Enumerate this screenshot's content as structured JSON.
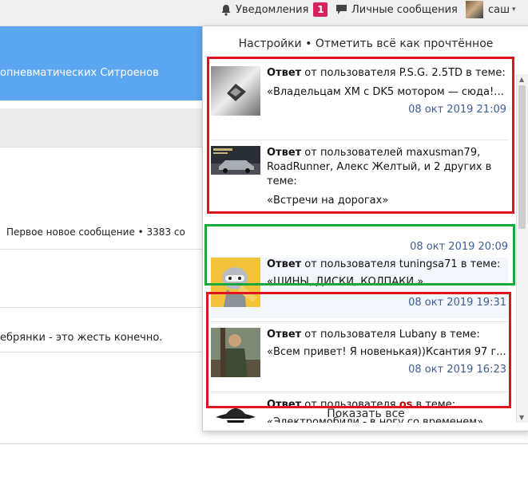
{
  "topbar": {
    "notifications_label": "Уведомления",
    "notifications_count": "1",
    "messages_label": "Личные сообщения",
    "user_label": "саш",
    "caret": "▾"
  },
  "background": {
    "blue_text": "опневматических Ситроенов",
    "thread_meta": "Первое новое сообщение • 3383 со",
    "post_snippet": "ебрянки - это жесть конечно."
  },
  "popup": {
    "settings_label": "Настройки",
    "separator": "•",
    "mark_read_label": "Отметить всё как прочтённое",
    "show_all_label": "Показать все",
    "items": [
      {
        "type": "Ответ",
        "prefix": " от пользователя ",
        "users": "P.S.G. 2.5TD",
        "suffix": " в теме:",
        "topic": "«Владельцам XM с DK5 мотором — сюда! ...",
        "time": "08 окт 2019 21:09"
      },
      {
        "type": "Ответ",
        "prefix": " от пользователей ",
        "users": "maxusman79, RoadRunner, Алекс Желтый, и 2 других",
        "suffix": " в теме:",
        "topic": "«Встречи на дорогах»",
        "time": "08 окт 2019 20:09"
      },
      {
        "type": "Ответ",
        "prefix": " от пользователя ",
        "users": "tuningsa71",
        "suffix": " в теме:",
        "topic": "«ШИНЫ, ДИСКИ, КОЛПАКИ.»",
        "time": "08 окт 2019 19:31"
      },
      {
        "type": "Ответ",
        "prefix": " от пользователя ",
        "users": "Lubany",
        "suffix": " в теме:",
        "topic": "«Всем привет! Я новенькая))Ксантия 97 г...",
        "time": "08 окт 2019 16:23"
      },
      {
        "type": "Ответ",
        "prefix": " от пользователя ",
        "users": "os",
        "suffix": " в теме:",
        "topic": "«Электромобили - в ногу со временем»",
        "time": ""
      }
    ]
  },
  "colors": {
    "badge": "#d5245a",
    "time_link": "#3e5d96",
    "header_blue": "#5ca6f2",
    "highlight_red": "#e0141e",
    "highlight_green": "#19a83c",
    "username_red": "#b00000"
  },
  "icons": {
    "notifications": "bell-icon",
    "messages": "chat-bubble-icon",
    "scroll_up": "arrow-up-icon",
    "scroll_down": "arrow-down-icon"
  }
}
